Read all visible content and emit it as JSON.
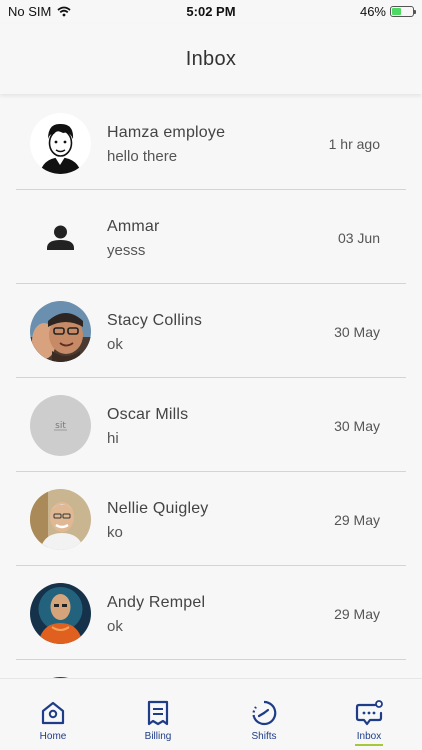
{
  "status_bar": {
    "carrier": "No SIM",
    "time": "5:02 PM",
    "battery": "46%",
    "battery_level": 0.46
  },
  "header": {
    "title": "Inbox"
  },
  "conversations": [
    {
      "name": "Hamza employe",
      "message": "hello there",
      "time": "1 hr ago",
      "avatar": "cartoon-avatar"
    },
    {
      "name": "Ammar",
      "message": "yesss",
      "time": "03 Jun",
      "avatar": "default-person-icon"
    },
    {
      "name": "Stacy Collins",
      "message": "ok",
      "time": "30 May",
      "avatar": "photo-avatar"
    },
    {
      "name": "Oscar Mills",
      "message": "hi",
      "time": "30 May",
      "avatar": "placeholder-avatar",
      "avatar_text": "sit"
    },
    {
      "name": "Nellie Quigley",
      "message": "ko",
      "time": "29 May",
      "avatar": "photo-avatar"
    },
    {
      "name": "Andy Rempel",
      "message": "ok",
      "time": "29 May",
      "avatar": "photo-avatar"
    }
  ],
  "tabs": [
    {
      "label": "Home",
      "icon": "home-icon"
    },
    {
      "label": "Billing",
      "icon": "billing-icon"
    },
    {
      "label": "Shifts",
      "icon": "shifts-icon"
    },
    {
      "label": "Inbox",
      "icon": "inbox-icon",
      "active": true
    }
  ],
  "colors": {
    "accent": "#1f3c88",
    "active_underline": "#a6c83c",
    "divider": "#d4d4d4"
  }
}
